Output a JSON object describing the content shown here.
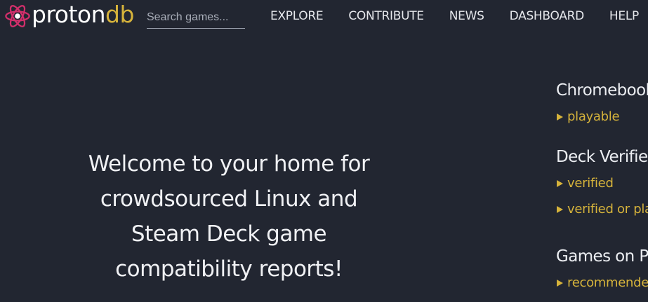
{
  "brand": {
    "name_part1": "proton",
    "name_part2": "db",
    "logo_icon": "atom-logo-icon",
    "colors": {
      "background": "#222631",
      "accent_gold": "#d6b33b",
      "logo_magenta": "#d22f6b"
    }
  },
  "search": {
    "placeholder": "Search games..."
  },
  "nav": {
    "items": [
      "EXPLORE",
      "CONTRIBUTE",
      "NEWS",
      "DASHBOARD",
      "HELP"
    ]
  },
  "welcome": {
    "text": "Welcome to your home for crowdsourced Linux and Steam Deck game compatibility reports!"
  },
  "sidebar": {
    "sections": [
      {
        "heading": "Chromebook",
        "links": [
          "playable"
        ]
      },
      {
        "heading": "Deck Verified",
        "links": [
          "verified",
          "verified or playable"
        ]
      },
      {
        "heading": "Games on Proton",
        "links": [
          "recommended"
        ]
      }
    ],
    "bullet_icon": "triangle-right-icon"
  }
}
